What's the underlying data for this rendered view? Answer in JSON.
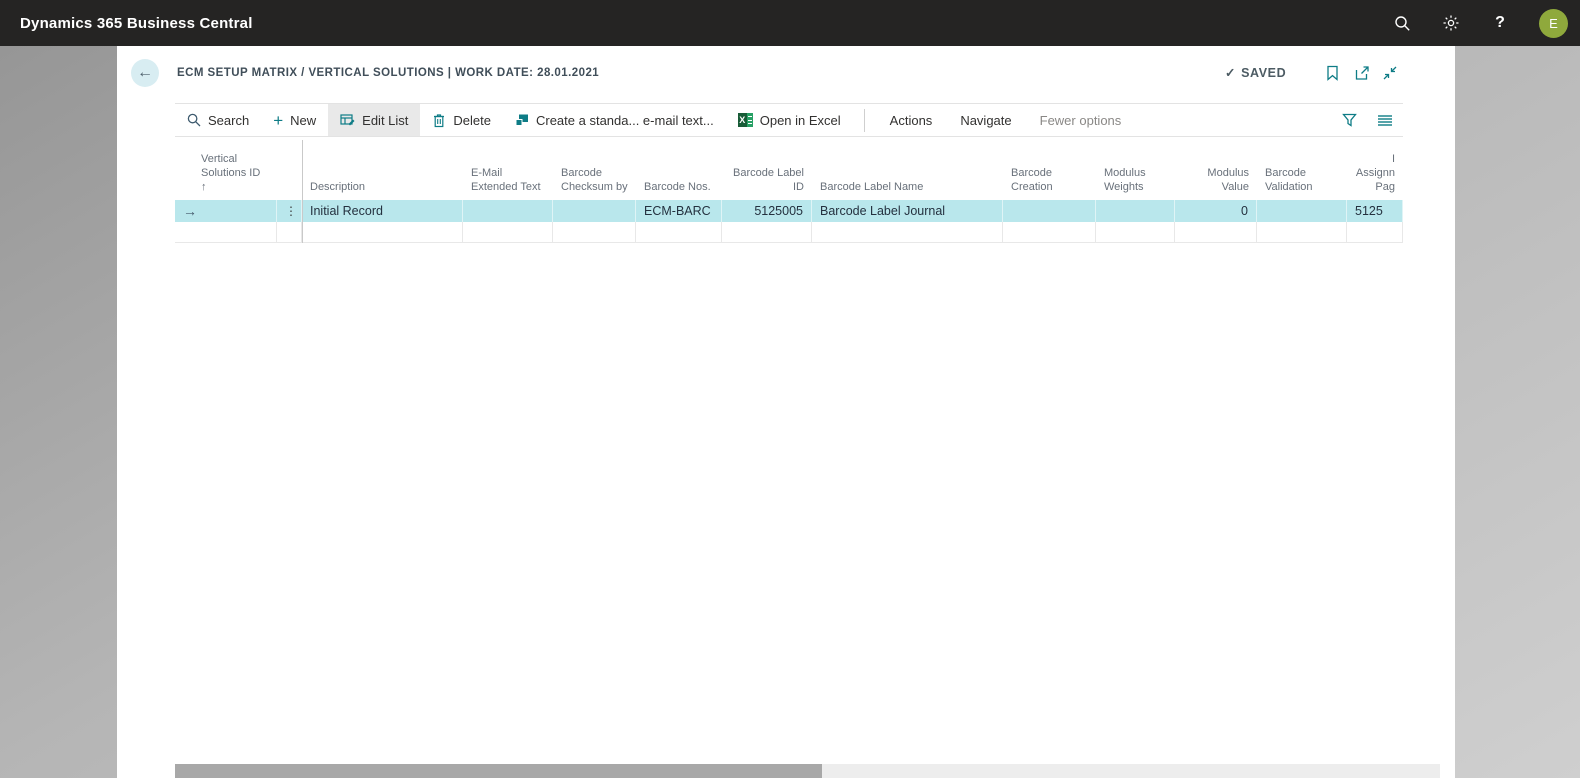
{
  "topbar": {
    "app_title": "Dynamics 365 Business Central",
    "help_label": "?",
    "avatar_initial": "E"
  },
  "page_header": {
    "title": "ECM SETUP MATRIX / VERTICAL SOLUTIONS | WORK DATE: 28.01.2021",
    "check_glyph": "✓",
    "save_status": "SAVED"
  },
  "toolbar": {
    "search_label": "Search",
    "new_label": "New",
    "new_glyph": "+",
    "edit_list_label": "Edit List",
    "delete_label": "Delete",
    "create_standard_label": "Create a standa... e-mail text...",
    "open_in_excel_label": "Open in Excel",
    "excel_glyph": "X",
    "actions_label": "Actions",
    "navigate_label": "Navigate",
    "fewer_options_label": "Fewer options"
  },
  "table": {
    "columns": [
      {
        "label": "Vertical Solutions ID",
        "sort_glyph": "↑"
      },
      {
        "label": ""
      },
      {
        "label": "Description"
      },
      {
        "label": "E-Mail Extended Text"
      },
      {
        "label": "Barcode Checksum by"
      },
      {
        "label": "Barcode Nos."
      },
      {
        "label": "Barcode Label ID"
      },
      {
        "label": "Barcode Label Name"
      },
      {
        "label": "Barcode Creation"
      },
      {
        "label": "Modulus Weights"
      },
      {
        "label": "Modulus Value"
      },
      {
        "label": "Barcode Validation"
      },
      {
        "label": "",
        "clipped_lines": [
          "I",
          "Assignn",
          "Pag"
        ]
      }
    ],
    "rows": [
      {
        "selector_glyph": "→",
        "menu_glyph": "⋮",
        "description": "Initial Record",
        "email_extended_text": "",
        "barcode_checksum_by": "",
        "barcode_nos": "ECM-BARC",
        "barcode_label_id": "5125005",
        "barcode_label_name": "Barcode Label Journal",
        "barcode_creation": "",
        "modulus_weights": "",
        "modulus_value": "0",
        "barcode_validation": "",
        "clipped_value": "5125"
      }
    ]
  },
  "colors": {
    "topbar_bg": "#252423",
    "accent_teal": "#0e7c86",
    "selected_row_bg": "#b9e7ec",
    "avatar_bg": "#8fa93c",
    "excel_green": "#185c37",
    "back_circle_bg": "#d8edf2"
  }
}
